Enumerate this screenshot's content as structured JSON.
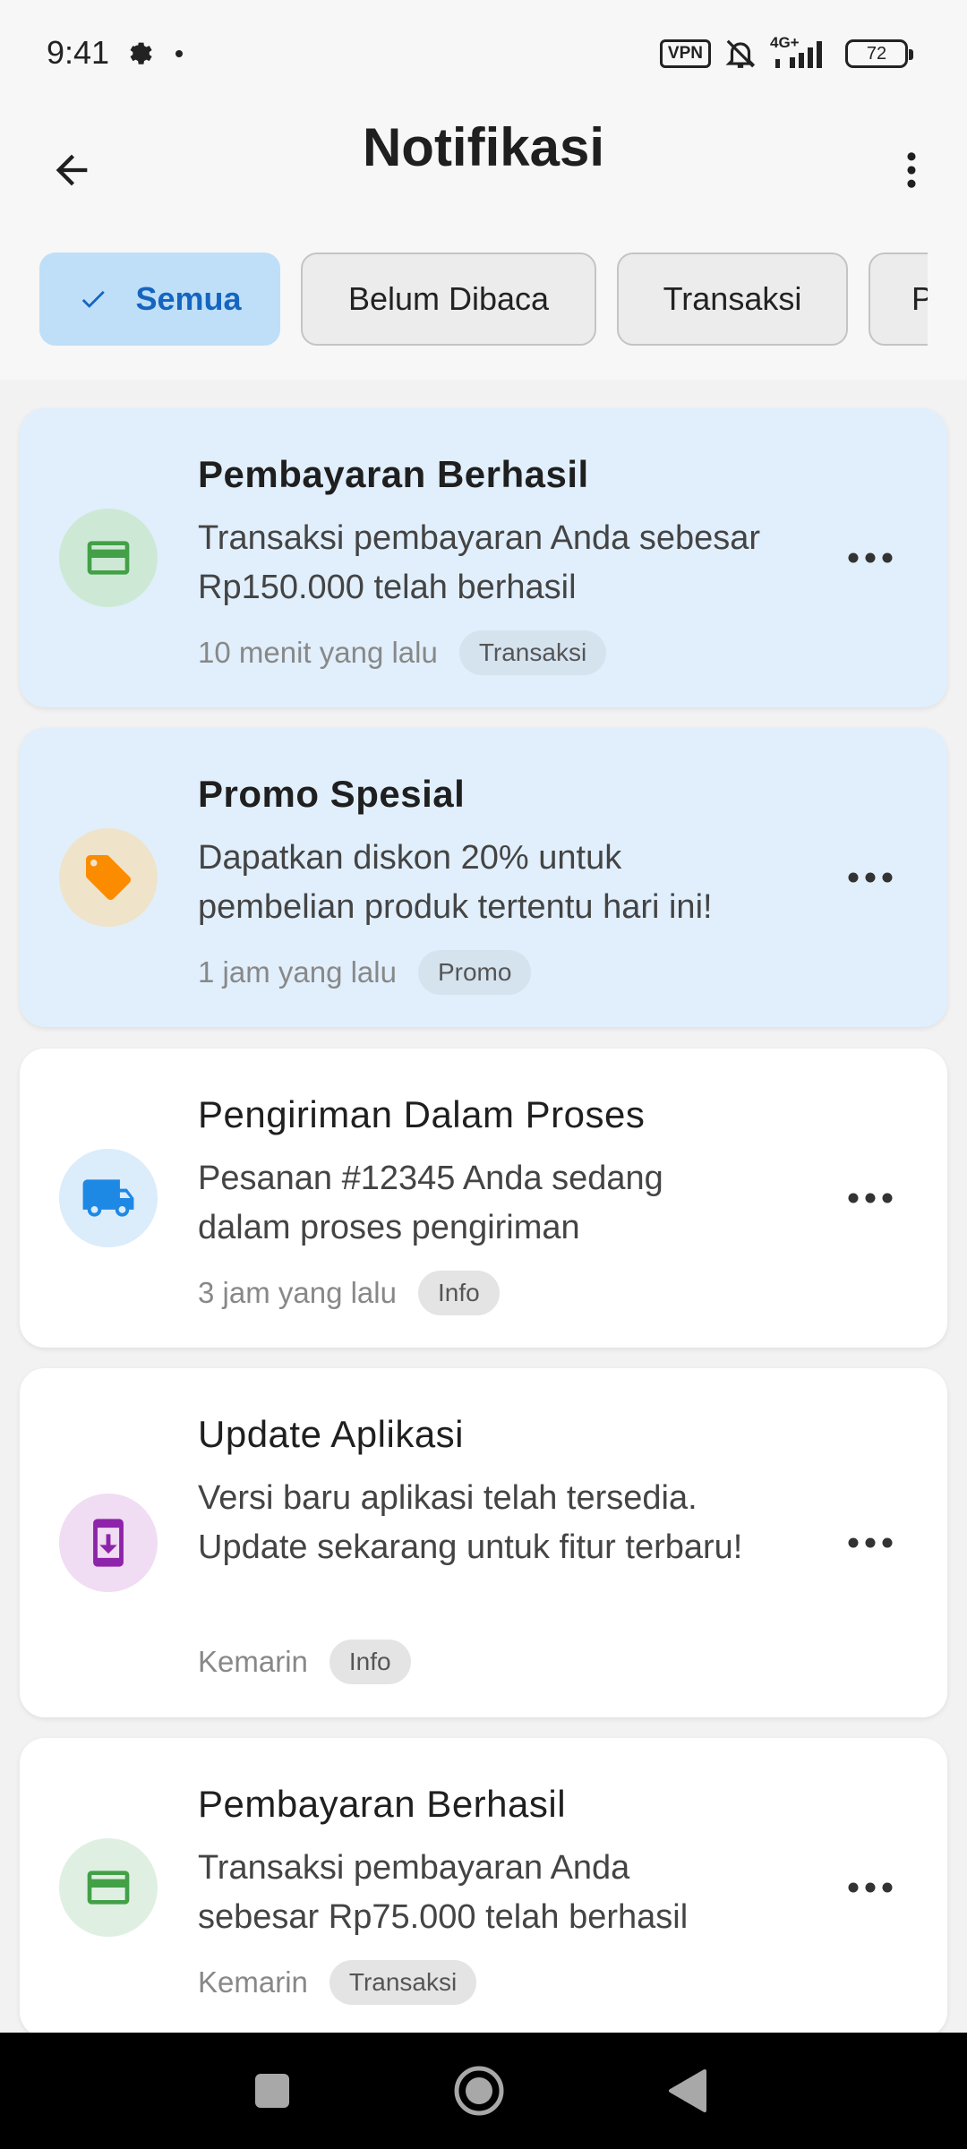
{
  "status_bar": {
    "time": "9:41",
    "vpn": "VPN",
    "network": "4G+",
    "battery": "72"
  },
  "app_bar": {
    "title": "Notifikasi",
    "back_icon": "arrow-back-icon",
    "menu_icon": "more-vert-icon"
  },
  "filters": [
    {
      "label": "Semua",
      "active": true
    },
    {
      "label": "Belum Dibaca",
      "active": false
    },
    {
      "label": "Transaksi",
      "active": false
    },
    {
      "label": "Promo",
      "active": false
    }
  ],
  "notifications": [
    {
      "title": "Pembayaran Berhasil",
      "message": "Transaksi pembayaran Anda sebesar Rp150.000 telah berhasil",
      "time": "10 menit yang lalu",
      "tag": "Transaksi",
      "unread": true,
      "icon": "credit-card-icon",
      "icon_color": "#43a047",
      "icon_bg": "#cde9d6"
    },
    {
      "title": "Promo Spesial",
      "message": "Dapatkan diskon 20% untuk pembelian produk tertentu hari ini!",
      "time": "1 jam yang lalu",
      "tag": "Promo",
      "unread": true,
      "icon": "tag-icon",
      "icon_color": "#fb8c00",
      "icon_bg": "#efe3c9"
    },
    {
      "title": "Pengiriman Dalam Proses",
      "message": "Pesanan #12345 Anda sedang dalam proses pengiriman",
      "time": "3 jam yang lalu",
      "tag": "Info",
      "unread": false,
      "icon": "truck-icon",
      "icon_color": "#1e88e5",
      "icon_bg": "#dbecfb"
    },
    {
      "title": "Update Aplikasi",
      "message": "Versi baru aplikasi telah tersedia. Update sekarang untuk fitur terbaru!",
      "time": "Kemarin",
      "tag": "Info",
      "unread": false,
      "icon": "system-update-icon",
      "icon_color": "#8e24aa",
      "icon_bg": "#f0dcf3"
    },
    {
      "title": "Pembayaran Berhasil",
      "message": "Transaksi pembayaran Anda sebesar Rp75.000 telah berhasil",
      "time": "Kemarin",
      "tag": "Transaksi",
      "unread": false,
      "icon": "credit-card-icon",
      "icon_color": "#43a047",
      "icon_bg": "#dff0e2"
    }
  ]
}
